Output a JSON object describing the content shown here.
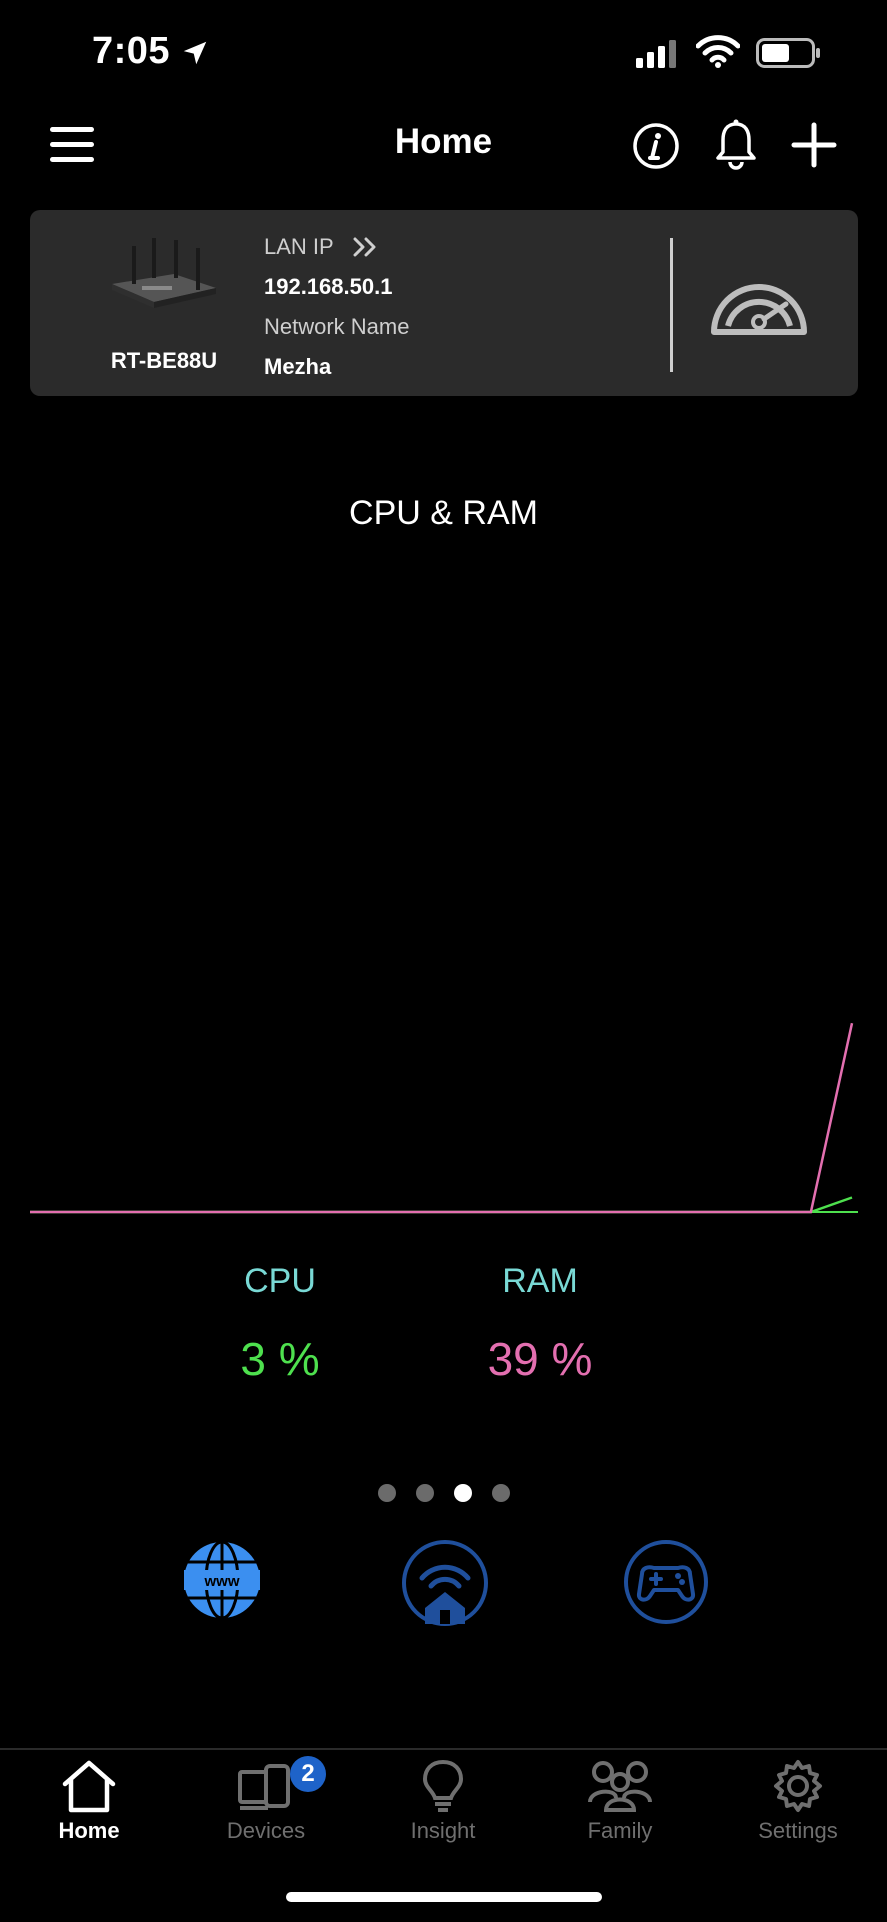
{
  "status_bar": {
    "time": "7:05"
  },
  "header": {
    "title": "Home"
  },
  "router_card": {
    "model": "RT-BE88U",
    "lan_ip_label": "LAN IP",
    "lan_ip": "192.168.50.1",
    "network_name_label": "Network Name",
    "network_name": "Mezha"
  },
  "chart_section": {
    "title": "CPU & RAM",
    "cpu_label": "CPU",
    "cpu_value": "3 %",
    "ram_label": "RAM",
    "ram_value": "39 %"
  },
  "chart_data": {
    "type": "line",
    "title": "CPU & RAM",
    "x": [
      0,
      1,
      2,
      3,
      4,
      5,
      6,
      7,
      8,
      9,
      10,
      11,
      12,
      13,
      14,
      15,
      16,
      17,
      18,
      19,
      20
    ],
    "series": [
      {
        "name": "CPU",
        "color": "#4ee04e",
        "values": [
          0,
          0,
          0,
          0,
          0,
          0,
          0,
          0,
          0,
          0,
          0,
          0,
          0,
          0,
          0,
          0,
          0,
          0,
          0,
          0,
          3
        ]
      },
      {
        "name": "RAM",
        "color": "#e36fb0",
        "values": [
          0,
          0,
          0,
          0,
          0,
          0,
          0,
          0,
          0,
          0,
          0,
          0,
          0,
          0,
          0,
          0,
          0,
          0,
          0,
          0,
          39
        ]
      }
    ],
    "ylim": [
      0,
      50
    ],
    "grid": false
  },
  "pager": {
    "count": 4,
    "active_index": 2
  },
  "quick_actions": [
    {
      "icon": "www-globe-icon",
      "color": "#3b8ff0"
    },
    {
      "icon": "home-wifi-icon",
      "color": "#1f4f9c"
    },
    {
      "icon": "gamepad-icon",
      "color": "#1f4f9c"
    }
  ],
  "tabbar": {
    "items": [
      {
        "label": "Home",
        "icon": "home-icon",
        "active": true
      },
      {
        "label": "Devices",
        "icon": "devices-icon",
        "badge": "2"
      },
      {
        "label": "Insight",
        "icon": "lightbulb-icon"
      },
      {
        "label": "Family",
        "icon": "family-icon"
      },
      {
        "label": "Settings",
        "icon": "gear-icon"
      }
    ]
  },
  "colors": {
    "cpu": "#4ee04e",
    "ram": "#e36fb0",
    "label_teal": "#79d9d5",
    "card_bg": "#2b2b2b",
    "badge": "#1e63c9"
  }
}
